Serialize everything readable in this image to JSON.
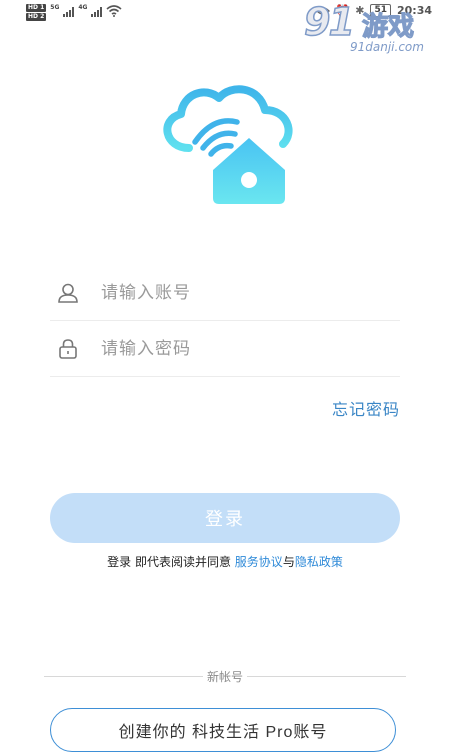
{
  "status_bar": {
    "sim1_label": "HD 1",
    "sim2_label": "HD 2",
    "net1": "5G",
    "net2": "4G",
    "battery": "51",
    "time": "20:34",
    "icons": [
      "eye-icon",
      "alarm-icon",
      "bluetooth-icon",
      "battery-icon",
      "wifi-icon",
      "signal-icon"
    ]
  },
  "watermark": {
    "number": "91",
    "text": "游戏",
    "url": "91danji.com"
  },
  "login_form": {
    "account_placeholder": "请输入账号",
    "password_placeholder": "请输入密码",
    "forgot_password": "忘记密码",
    "login_button": "登录"
  },
  "agreement": {
    "prefix": "登录 即代表阅读并同意 ",
    "service_link": "服务协议",
    "conjunction": "与",
    "privacy_link": "隐私政策"
  },
  "register": {
    "divider_label": "新帐号",
    "button_label": "创建你的 科技生活 Pro账号"
  },
  "colors": {
    "accent": "#3a86c6",
    "login_button_bg": "#c3def8",
    "logo_gradient_top": "#3fb5ea",
    "logo_gradient_bottom": "#5fe0ef"
  }
}
